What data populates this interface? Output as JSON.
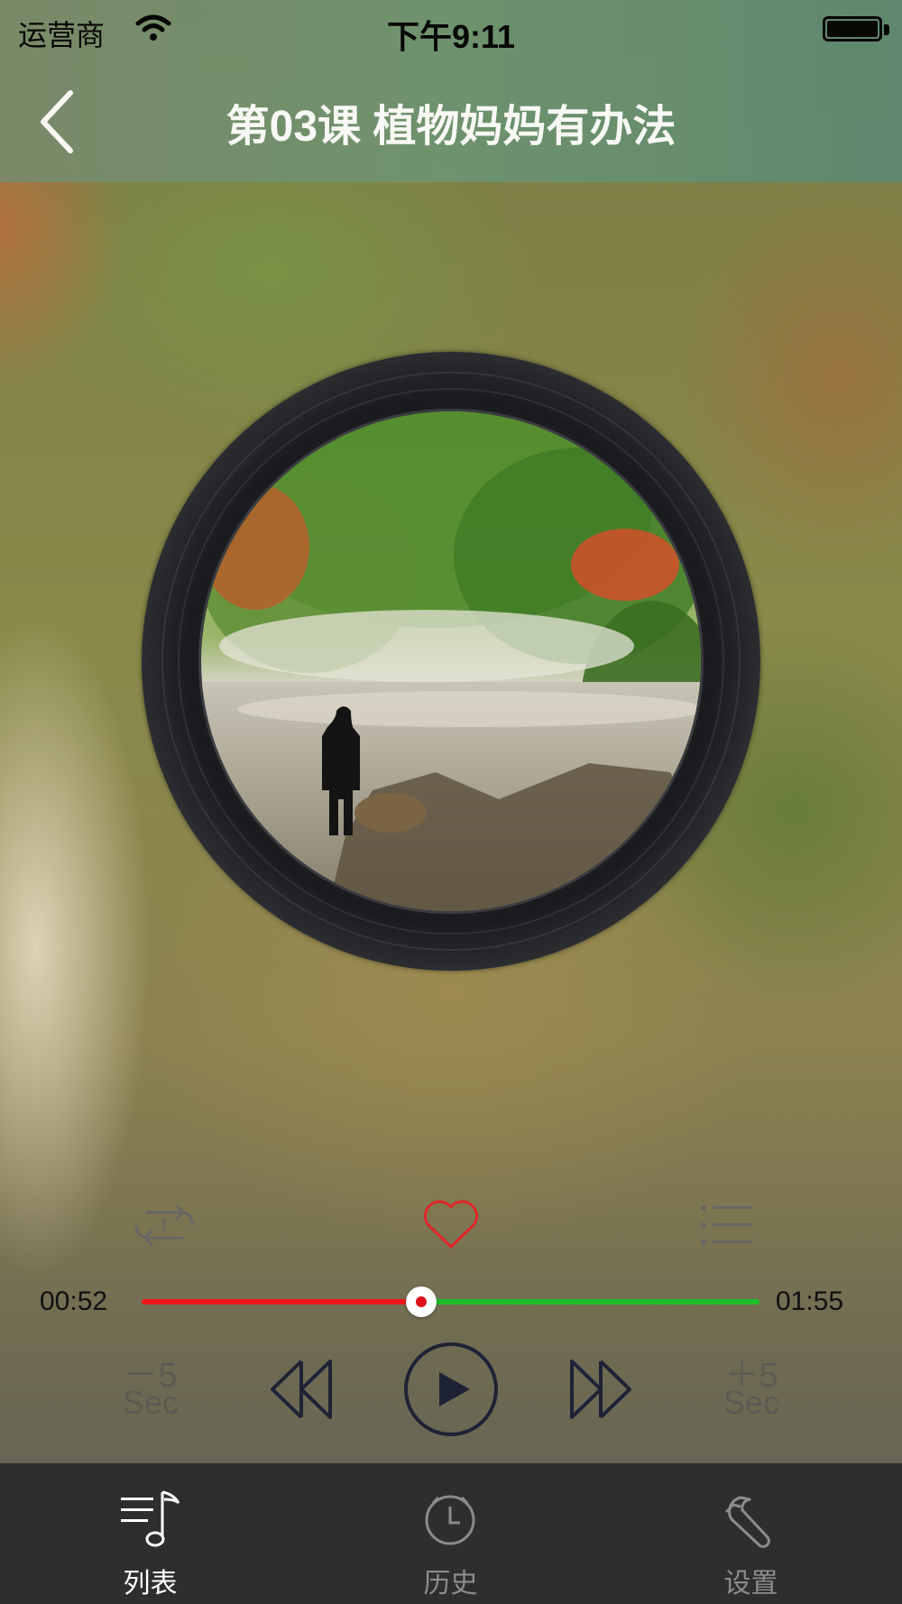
{
  "status_bar": {
    "carrier": "运营商",
    "time": "下午9:11"
  },
  "header": {
    "title": "第03课 植物妈妈有办法",
    "back_icon": "chevron-left-icon"
  },
  "player": {
    "current_time": "00:52",
    "total_time": "01:55",
    "progress_fraction": 0.452,
    "repeat_mode": "repeat-one",
    "favorite": true,
    "rewind_label": {
      "sign": "－5",
      "unit": "Sec"
    },
    "forward_label": {
      "sign": "＋5",
      "unit": "Sec"
    }
  },
  "colors": {
    "progress_played": "#f01818",
    "progress_remaining": "#1fbf2a",
    "favorite": "#e0262a",
    "tab_active": "#ffffff",
    "tab_inactive": "#8c8c8c"
  },
  "tabs": [
    {
      "label": "列表",
      "icon": "music-list-icon",
      "active": true
    },
    {
      "label": "历史",
      "icon": "clock-icon",
      "active": false
    },
    {
      "label": "设置",
      "icon": "wrench-icon",
      "active": false
    }
  ]
}
